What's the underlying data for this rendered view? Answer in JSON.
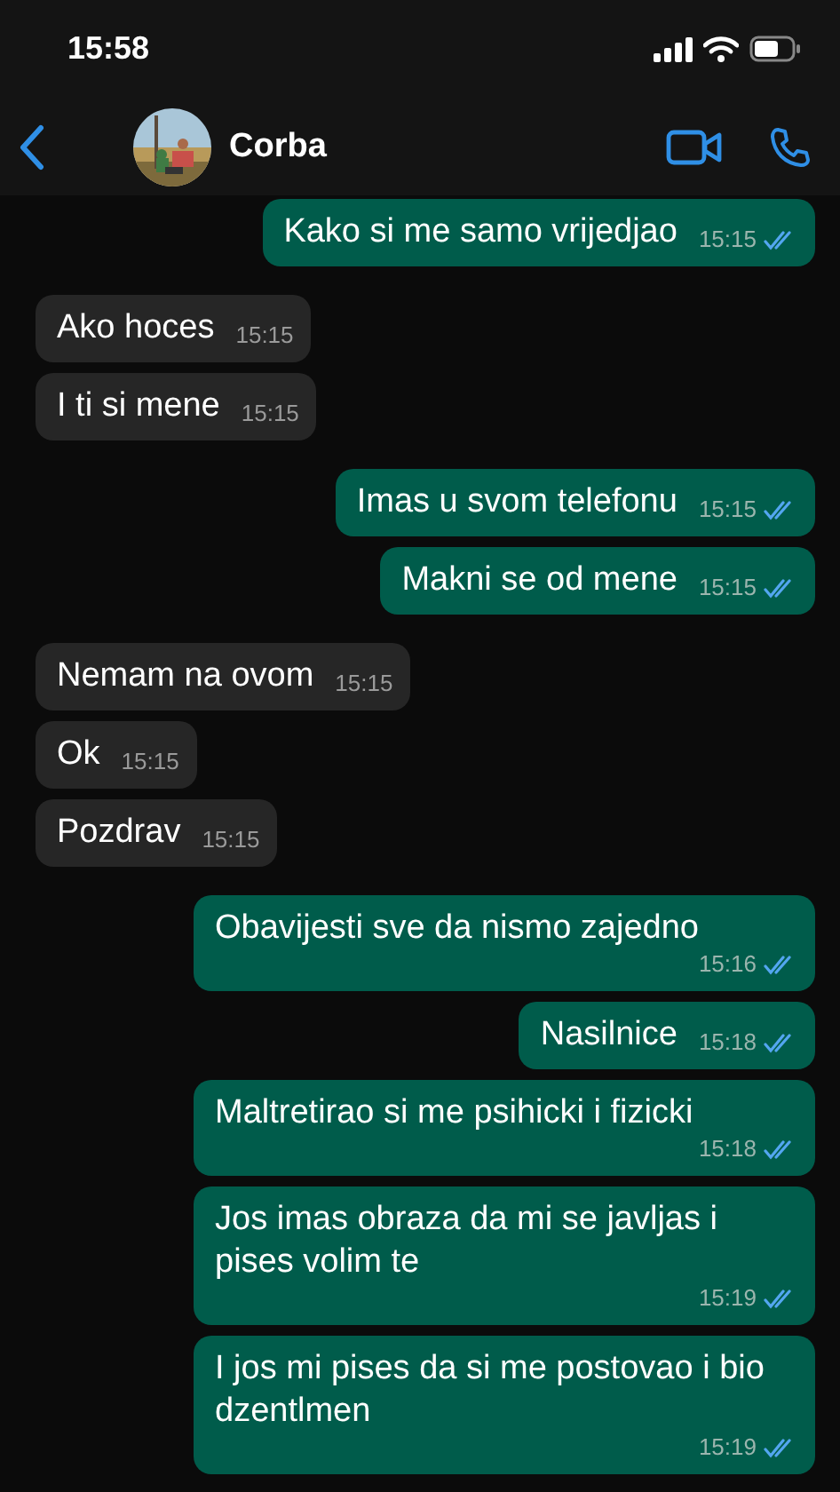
{
  "status_bar": {
    "time": "15:58"
  },
  "header": {
    "contact_name": "Corba"
  },
  "messages": [
    {
      "kind": "outgoing",
      "text": "Kako si me samo vrijedjao",
      "time": "15:15",
      "read": true
    },
    {
      "kind": "incoming",
      "text": "Ako hoces",
      "time": "15:15"
    },
    {
      "kind": "incoming",
      "text": "I ti si mene",
      "time": "15:15"
    },
    {
      "kind": "outgoing",
      "text": "Imas u svom telefonu",
      "time": "15:15",
      "read": true
    },
    {
      "kind": "outgoing",
      "text": "Makni se od mene",
      "time": "15:15",
      "read": true
    },
    {
      "kind": "incoming",
      "text": "Nemam na ovom",
      "time": "15:15"
    },
    {
      "kind": "incoming",
      "text": "Ok",
      "time": "15:15"
    },
    {
      "kind": "incoming",
      "text": "Pozdrav",
      "time": "15:15"
    },
    {
      "kind": "outgoing",
      "text": "Obavijesti sve da nismo zajedno",
      "time": "15:16",
      "read": true
    },
    {
      "kind": "outgoing",
      "text": "Nasilnice",
      "time": "15:18",
      "read": true
    },
    {
      "kind": "outgoing",
      "text": "Maltretirao si me psihicki i fizicki",
      "time": "15:18",
      "read": true
    },
    {
      "kind": "outgoing",
      "text": "Jos imas obraza da mi se javljas i pises volim te",
      "time": "15:19",
      "read": true
    },
    {
      "kind": "outgoing",
      "text": "I jos mi pises da si me postovao i bio dzentlmen",
      "time": "15:19",
      "read": true
    }
  ]
}
